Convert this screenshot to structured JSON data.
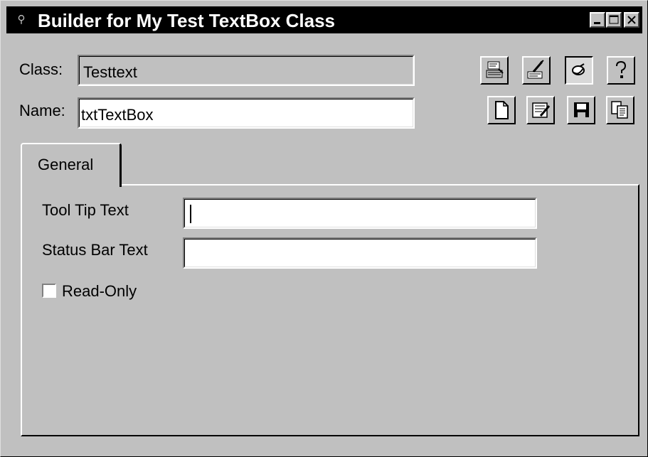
{
  "window": {
    "title": "Builder for My Test TextBox Class",
    "icon": "builder-app-icon",
    "controls": [
      "minimize-icon",
      "maximize-icon",
      "close-icon"
    ]
  },
  "form": {
    "class_label": "Class:",
    "class_value": "Testtext",
    "name_label": "Name:",
    "name_value": "txtTextBox"
  },
  "toolbar": {
    "buttons": [
      {
        "icon": "properties-icon",
        "pressed": false
      },
      {
        "icon": "code-brush-icon",
        "pressed": false
      },
      {
        "icon": "browse-icon",
        "pressed": true
      },
      {
        "icon": "help-icon",
        "pressed": false
      },
      {
        "icon": "new-document-icon",
        "pressed": false
      },
      {
        "icon": "edit-notes-icon",
        "pressed": false
      },
      {
        "icon": "save-icon",
        "pressed": false
      },
      {
        "icon": "copy-icon",
        "pressed": false
      }
    ]
  },
  "tabs": {
    "active_label": "General"
  },
  "general": {
    "tooltip_label": "Tool Tip Text",
    "tooltip_value": "",
    "statusbar_label": "Status Bar Text",
    "statusbar_value": "",
    "readonly_label": "Read-Only",
    "readonly_checked": false
  },
  "colors": {
    "face": "#c0c0c0",
    "titlebar": "#000000",
    "field": "#ffffff"
  }
}
